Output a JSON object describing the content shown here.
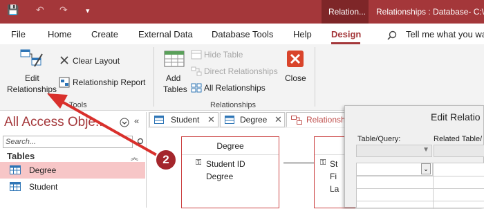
{
  "titlebar": {
    "qat": {
      "save": "💾",
      "undo": "↶",
      "redo": "↷",
      "customize": "▾"
    },
    "context_tab": "Relation...",
    "document_title": "Relationships : Database- C:\\U"
  },
  "menu": {
    "items": [
      "File",
      "Home",
      "Create",
      "External Data",
      "Database Tools",
      "Help",
      "Design"
    ],
    "active": "Design",
    "tell_me": "Tell me what you wa"
  },
  "ribbon": {
    "tools": {
      "edit_line1": "Edit",
      "edit_line2": "Relationships",
      "clear_layout": "Clear Layout",
      "relationship_report": "Relationship Report",
      "group_label": "Tools"
    },
    "relationships": {
      "add_tables_line1": "Add",
      "add_tables_line2": "Tables",
      "hide_table": "Hide Table",
      "direct_relationships": "Direct Relationships",
      "all_relationships": "All Relationships",
      "group_label": "Relationships"
    },
    "close": "Close"
  },
  "nav": {
    "title": "All Access Obje...",
    "search_placeholder": "Search...",
    "section": "Tables",
    "items": [
      {
        "label": "Degree",
        "selected": true
      },
      {
        "label": "Student",
        "selected": false
      }
    ]
  },
  "tabs": [
    {
      "label": "Student"
    },
    {
      "label": "Degree"
    },
    {
      "label": "Relationship"
    }
  ],
  "canvas": {
    "table1": {
      "title": "Degree",
      "fields": [
        "Student ID",
        "Degree"
      ]
    },
    "table2": {
      "field_prefixes": [
        "St",
        "Fi",
        "La"
      ]
    }
  },
  "dialog": {
    "title": "Edit Relatio",
    "col1": "Table/Query:",
    "col2": "Related Table/"
  },
  "annotation": {
    "step": "2"
  },
  "colors": {
    "brand": "#a4373a",
    "arrow": "#d9302c",
    "selected_row": "#f7c6c7"
  }
}
